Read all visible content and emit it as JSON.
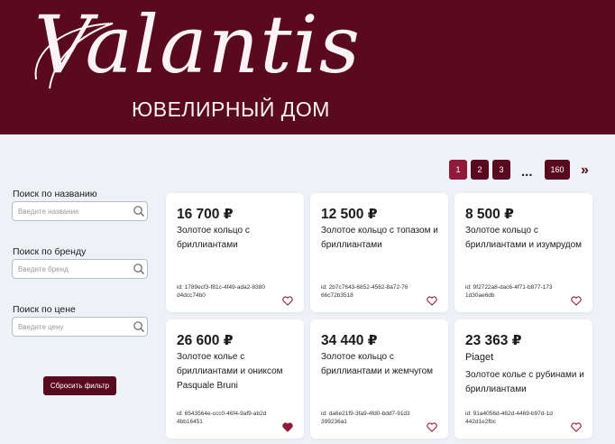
{
  "header": {
    "logo_script": "Valantis",
    "logo_subtitle": "ЮВЕЛИРНЫЙ ДОМ",
    "bg_color": "#5a0a1e"
  },
  "pagination": {
    "pages": [
      "1",
      "2",
      "3"
    ],
    "dots": "...",
    "last_page": "160",
    "next": "»",
    "current": "1"
  },
  "filters": {
    "name": {
      "label": "Поиск по названию",
      "placeholder": "Введите название",
      "value": ""
    },
    "brand": {
      "label": "Поиск по бренду",
      "placeholder": "Введите бренд",
      "value": ""
    },
    "price": {
      "label": "Поиск по цене",
      "placeholder": "Введите цену",
      "value": ""
    },
    "reset_label": "Сбросить фильтр"
  },
  "products": [
    {
      "price": "16 700 ₽",
      "brand": "",
      "title": "Золотое кольцо с бриллиантами",
      "id": "id: 1789ecf3-f81c-4f49-ada2-8380d4dcc74b0",
      "favorite": false
    },
    {
      "price": "12 500 ₽",
      "brand": "",
      "title": "Золотое кольцо с топазом и бриллиантами",
      "id": "id: 2b7c7643-6852-4562-8a72-7666c72b3518",
      "favorite": false
    },
    {
      "price": "8 500 ₽",
      "brand": "",
      "title": "Золотое кольцо с бриллиантами и изумрудом",
      "id": "id: 9f2722a8-dac6-4f71-b877-1731d30ae6db",
      "favorite": false
    },
    {
      "price": "26 600 ₽",
      "brand": "",
      "title": "Золотое колье с бриллиантами и ониксом Pasquale Bruni",
      "id": "id: 6543564e-ccc0-46f4-9af9-ab2d4bb16451",
      "favorite": true
    },
    {
      "price": "34 440 ₽",
      "brand": "",
      "title": "Золотое кольцо с бриллиантами и жемчугом",
      "id": "id: da6e21f9-3fa9-4fd0-bdd7-91d3399236a1",
      "favorite": false
    },
    {
      "price": "23 363 ₽",
      "brand": "Piaget",
      "title": "Золотое колье с рубинами и бриллиантами",
      "id": "id: 91a4056d-462d-4469-b97d-1d442d1e2fbc",
      "favorite": false
    }
  ],
  "icons": {
    "search": "search-icon",
    "favorite": "heart-icon",
    "next": "chevron-right-icon"
  },
  "colors": {
    "accent": "#5a0a1e",
    "accent_active": "#8f1a3a",
    "background": "#eef1f6",
    "heart": "#8f1a3a"
  }
}
